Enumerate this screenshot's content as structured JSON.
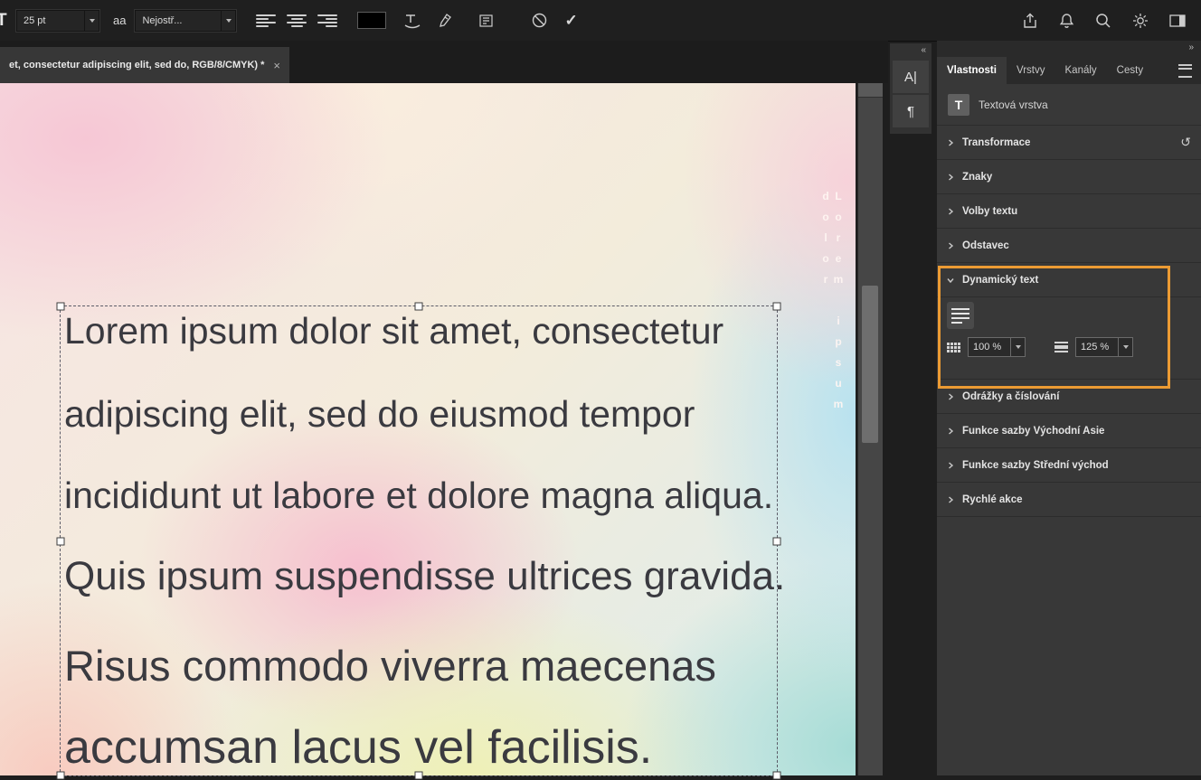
{
  "options_bar": {
    "tool_glyph": "T",
    "font_size": "25 pt",
    "anti_alias_icon": "aa",
    "anti_alias_value": "Nejostř...",
    "commit_glyph": "✓"
  },
  "doc_tab": {
    "title": "et, consectetur adipiscing elit, sed do, RGB/8/CMYK) *",
    "close_glyph": "×"
  },
  "canvas": {
    "text_lines": [
      "Lorem ipsum dolor sit amet, consectetur",
      "adipiscing elit, sed do eiusmod tempor",
      "incididunt ut labore et dolore magna aliqua.",
      "Quis ipsum suspendisse ultrices gravida.",
      "Risus commodo viverra maecenas",
      "accumsan lacus vel facilisis."
    ],
    "vertical_text": "Lorem ipsum dolor"
  },
  "dock": {
    "collapse_glyph": "«",
    "character_panel_glyph": "A|",
    "paragraph_panel_glyph": "¶"
  },
  "panel": {
    "collapse_glyph": "»",
    "tabs": [
      "Vlastnosti",
      "Vrstvy",
      "Kanály",
      "Cesty"
    ],
    "layer_type": {
      "icon_glyph": "T",
      "label": "Textová vrstva"
    },
    "sections": {
      "transform": "Transformace",
      "characters": "Znaky",
      "type_options": "Volby textu",
      "paragraph": "Odstavec",
      "dynamic_text": "Dynamický text",
      "bullets": "Odrážky a číslování",
      "east_asian": "Funkce sazby Východní Asie",
      "middle_east": "Funkce sazby Střední východ",
      "quick_actions": "Rychlé akce"
    },
    "dynamic_text_controls": {
      "scale_value": "100 %",
      "leading_value": "125 %"
    },
    "reset_glyph": "↺",
    "highlight_color": "#EC9B33"
  }
}
